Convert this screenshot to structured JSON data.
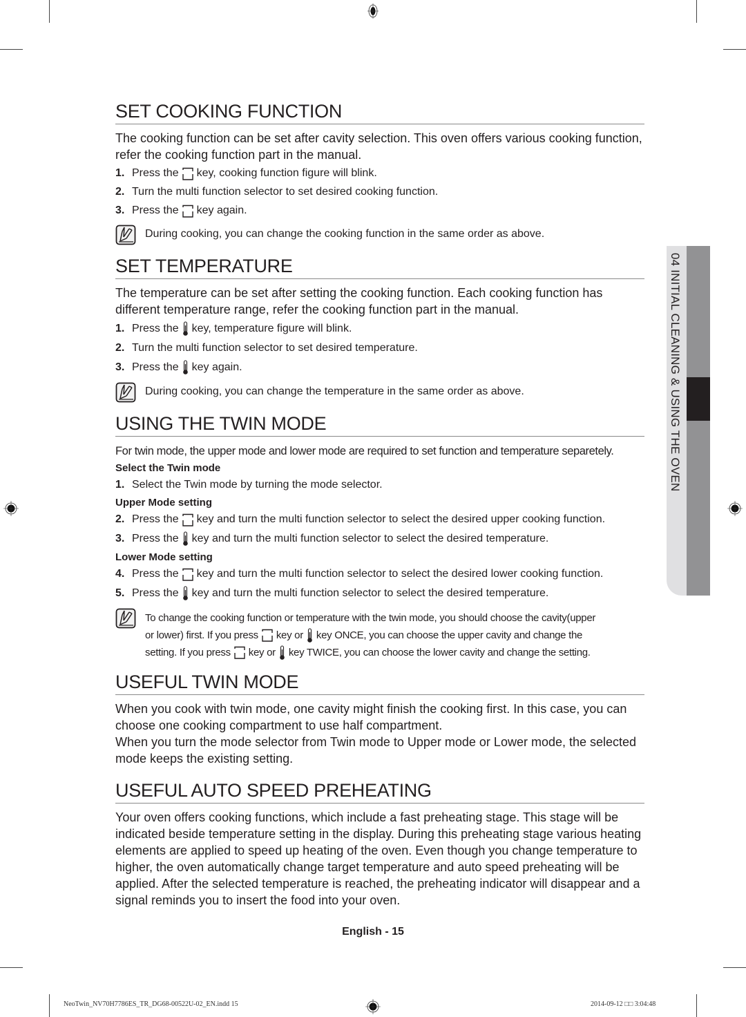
{
  "sections": {
    "set_cooking_function": {
      "title": "SET COOKING FUNCTION",
      "intro": "The cooking function can be set after cavity selection. This oven offers various cooking function, refer the cooking function part in the manual.",
      "steps": [
        {
          "num": "1.",
          "before": "Press the",
          "icon": "function-key-icon",
          "after": "key, cooking function figure will blink."
        },
        {
          "num": "2.",
          "before": "Turn the multi function selector to set desired cooking function.",
          "icon": "",
          "after": ""
        },
        {
          "num": "3.",
          "before": "Press the",
          "icon": "function-key-icon",
          "after": "key again."
        }
      ],
      "note": "During cooking, you can change the cooking function in the same order as above."
    },
    "set_temperature": {
      "title": "SET TEMPERATURE",
      "intro": "The temperature can be set after setting the cooking function. Each cooking function has different temperature range, refer the cooking function part in the manual.",
      "steps": [
        {
          "num": "1.",
          "before": "Press the",
          "icon": "thermometer-icon",
          "after": "key, temperature figure will blink."
        },
        {
          "num": "2.",
          "before": "Turn the multi function selector to set desired temperature.",
          "icon": "",
          "after": ""
        },
        {
          "num": "3.",
          "before": "Press the",
          "icon": "thermometer-icon",
          "after": "key again."
        }
      ],
      "note": "During cooking, you can change the temperature in the same order as above."
    },
    "using_twin_mode": {
      "title": "USING THE TWIN MODE",
      "intro": "For twin mode, the upper mode and lower mode are required to set function and temperature separetely.",
      "select_heading": "Select the Twin mode",
      "select_step": {
        "num": "1.",
        "text": "Select the Twin mode by turning the mode selector."
      },
      "upper_heading": "Upper Mode setting",
      "upper_steps": [
        {
          "num": "2.",
          "before": "Press the",
          "icon": "function-key-icon",
          "after": "key and turn the multi function selector to select the desired upper cooking function."
        },
        {
          "num": "3.",
          "before": "Press the",
          "icon": "thermometer-icon",
          "after": "key and turn the multi function selector to select the desired temperature."
        }
      ],
      "lower_heading": "Lower Mode setting",
      "lower_steps": [
        {
          "num": "4.",
          "before": "Press the",
          "icon": "function-key-icon",
          "after": "key and turn the multi function selector to select the desired lower cooking function."
        },
        {
          "num": "5.",
          "before": "Press the",
          "icon": "thermometer-icon",
          "after": "key and turn the multi function selector to select the desired temperature."
        }
      ],
      "note": {
        "line1": "To change the cooking function or temperature with the twin mode, you should choose the cavity(upper",
        "line2_a": "or lower) first. If you press",
        "line2_b": "key or",
        "line2_c": "key ONCE, you can choose the upper cavity and change the",
        "line3_a": "setting. If you press",
        "line3_b": "key or",
        "line3_c": "key TWICE, you can choose the lower cavity and change the setting."
      }
    },
    "useful_twin_mode": {
      "title": "USEFUL TWIN MODE",
      "para1": "When you cook with twin mode, one cavity might finish the cooking first. In this case, you can choose one cooking compartment to use half compartment.",
      "para2": "When you turn the mode selector from Twin mode to Upper mode or Lower mode, the selected mode keeps the existing setting."
    },
    "useful_auto_speed_preheating": {
      "title": "USEFUL AUTO SPEED PREHEATING",
      "para": "Your oven offers cooking functions, which include a fast preheating stage. This stage will be indicated beside temperature setting in the display. During this preheating stage various heating elements are applied to speed up heating of the oven. Even though you change temperature to higher, the oven automatically change target temperature and auto speed preheating will be applied. After the selected temperature is reached, the preheating indicator will disappear and a signal reminds you to insert the food into your oven."
    }
  },
  "side_tab": {
    "label": "04  INITIAL CLEANING & USING THE OVEN"
  },
  "footer": {
    "page_label": "English - 15",
    "file_slug": "NeoTwin_NV70H7786ES_TR_DG68-00522U-02_EN.indd   15",
    "date_slug": "2014-09-12   □□ 3:04:48"
  },
  "colors": {
    "text": "#231f20",
    "rule": "#888888",
    "tab_light": "#e0e0e2",
    "tab_dark": "#929294",
    "tab_marker": "#231f20"
  }
}
